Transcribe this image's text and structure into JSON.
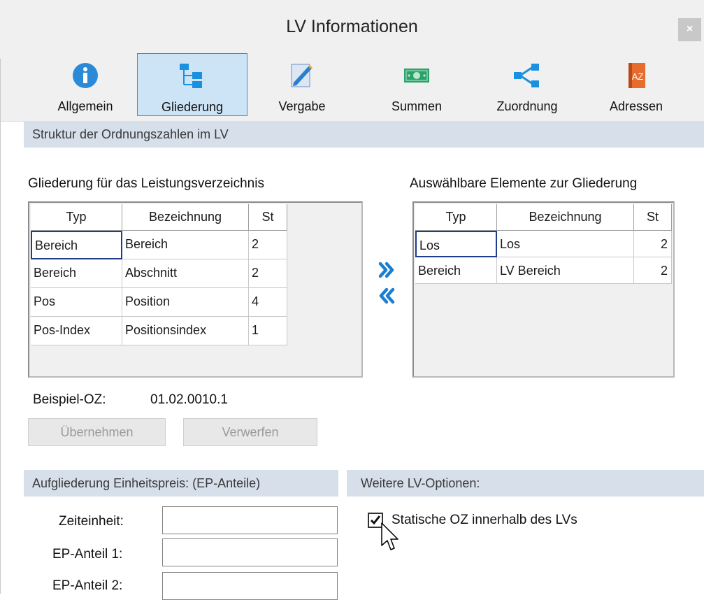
{
  "window": {
    "title": "LV Informationen",
    "close_glyph": "×"
  },
  "toolbar": {
    "items": [
      {
        "label": "Allgemein",
        "icon": "info-icon"
      },
      {
        "label": "Gliederung",
        "icon": "hierarchy-icon",
        "active": true
      },
      {
        "label": "Vergabe",
        "icon": "pencil-notepad-icon"
      },
      {
        "label": "Summen",
        "icon": "money-icon"
      },
      {
        "label": "Zuordnung",
        "icon": "share-network-icon"
      },
      {
        "label": "Adressen",
        "icon": "address-book-icon"
      }
    ]
  },
  "structure": {
    "header": "Struktur der Ordnungszahlen im LV",
    "left_title": "Gliederung für das Leistungsverzeichnis",
    "right_title": "Auswählbare Elemente zur Gliederung",
    "columns": [
      "Typ",
      "Bezeichnung",
      "St"
    ],
    "left_rows": [
      [
        "Bereich",
        "Bereich",
        "2"
      ],
      [
        "Bereich",
        "Abschnitt",
        "2"
      ],
      [
        "Pos",
        "Position",
        "4"
      ],
      [
        "Pos-Index",
        "Positionsindex",
        "1"
      ]
    ],
    "right_rows": [
      [
        "Los",
        "Los",
        "2"
      ],
      [
        "Bereich",
        "LV Bereich",
        "2"
      ]
    ],
    "example_label": "Beispiel-OZ:",
    "example_value": "01.02.0010.1",
    "apply_label": "Übernehmen",
    "discard_label": "Verwerfen"
  },
  "ep": {
    "header": "Aufgliederung Einheitspreis: (EP-Anteile)",
    "fields": [
      {
        "label": "Zeiteinheit:",
        "value": ""
      },
      {
        "label": "EP-Anteil 1:",
        "value": ""
      },
      {
        "label": "EP-Anteil 2:",
        "value": ""
      }
    ]
  },
  "options": {
    "header": "Weitere LV-Optionen:",
    "static_oz_label": "Statische OZ innerhalb des LVs",
    "static_oz_checked": true
  },
  "colors": {
    "accent": "#3c8be0",
    "section_bg": "#d6dfea",
    "toolbar_bg": "#f0f0f0",
    "selection_border": "#1e3e8a",
    "arrow": "#1a7fd1"
  }
}
